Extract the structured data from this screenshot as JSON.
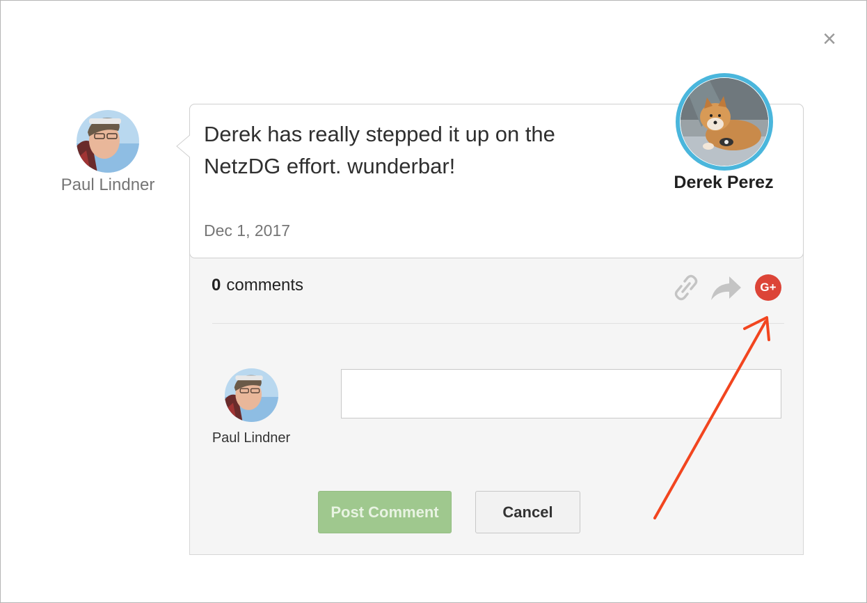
{
  "post": {
    "author_name": "Paul Lindner",
    "message": "Derek has really stepped it up on the NetzDG effort. wunderbar!",
    "date": "Dec 1, 2017",
    "recipient_name": "Derek Perez"
  },
  "comments": {
    "count": "0",
    "label": "comments",
    "share_icons": [
      "link-icon",
      "share-icon",
      "google-plus-icon"
    ],
    "gplus_label": "G+"
  },
  "compose": {
    "commenter_name": "Paul Lindner",
    "input_value": "",
    "post_label": "Post Comment",
    "cancel_label": "Cancel"
  },
  "dialog": {
    "close_label": "×"
  },
  "colors": {
    "gplus_red": "#dc4437",
    "avatar_ring": "#4ab6dc",
    "post_button": "#9fc88e",
    "annotation_arrow": "#f2451f"
  }
}
